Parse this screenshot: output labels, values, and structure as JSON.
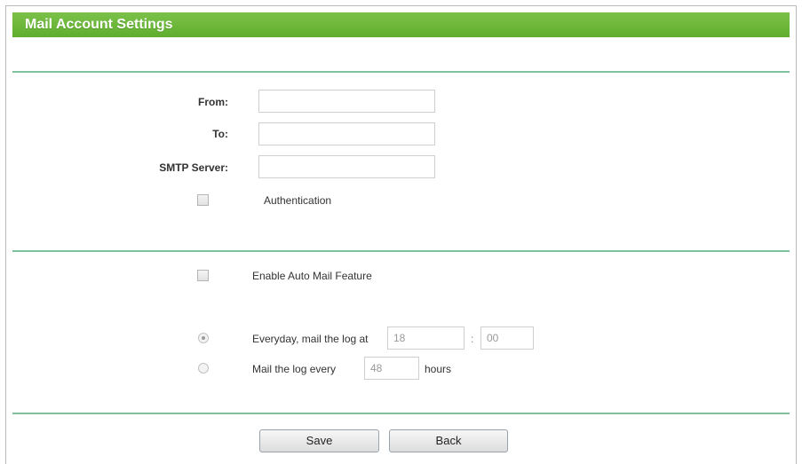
{
  "header": {
    "title": "Mail Account Settings"
  },
  "fields": {
    "from_label": "From:",
    "to_label": "To:",
    "smtp_label": "SMTP Server:",
    "auth_label": "Authentication",
    "from_value": "",
    "to_value": "",
    "smtp_value": ""
  },
  "auto_mail": {
    "enable_label": "Enable Auto Mail Feature",
    "everyday_label": "Everyday, mail the log at",
    "hour_value": "18",
    "minute_value": "00",
    "colon": ":",
    "interval_label": "Mail the log every",
    "interval_value": "48",
    "hours_label": "hours",
    "selected_option": "everyday"
  },
  "buttons": {
    "save_label": "Save",
    "back_label": "Back"
  },
  "colors": {
    "header_green": "#5fae2e",
    "separator": "#7fc19c"
  }
}
